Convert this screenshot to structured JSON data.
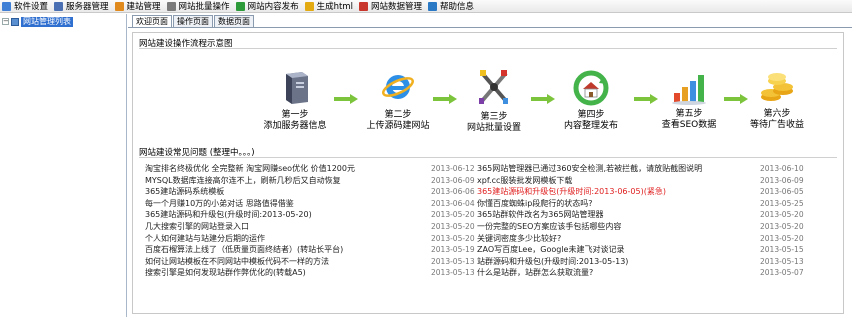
{
  "menubar": [
    {
      "label": "软件设置",
      "color": "#3f7fd6"
    },
    {
      "label": "服务器管理",
      "color": "#4a6fb3"
    },
    {
      "label": "建站管理",
      "color": "#e08a1e"
    },
    {
      "label": "网站批量操作",
      "color": "#7a7a7a"
    },
    {
      "label": "网站内容发布",
      "color": "#2d9b3a"
    },
    {
      "label": "生成html",
      "color": "#e3aa12"
    },
    {
      "label": "网站数据管理",
      "color": "#c8362c"
    },
    {
      "label": "帮助信息",
      "color": "#2a79c4"
    }
  ],
  "sidebar": {
    "toggle": "−",
    "tree_root": "网站管理列表"
  },
  "tabs": [
    "欢迎页面",
    "操作页面",
    "数据页面"
  ],
  "flow": {
    "title": "网站建设操作流程示意图",
    "steps": [
      {
        "line1": "第一步",
        "line2": "添加服务器信息",
        "icon": "server-icon"
      },
      {
        "line1": "第二步",
        "line2": "上传源码建网站",
        "icon": "ie-icon"
      },
      {
        "line1": "第三步",
        "line2": "网站批量设置",
        "icon": "tools-icon"
      },
      {
        "line1": "第四步",
        "line2": "内容整理发布",
        "icon": "home-refresh-icon"
      },
      {
        "line1": "第五步",
        "line2": "查看SEO数据",
        "icon": "bar-chart-icon"
      },
      {
        "line1": "第六步",
        "line2": "等待广告收益",
        "icon": "coins-icon"
      }
    ]
  },
  "faq": {
    "title": "网站建设常见问题 (整理中。。。)",
    "left": [
      {
        "title": "淘宝排名终极优化 全完整新 淘宝网赚seo优化 价值1200元",
        "date": "2013-06-12"
      },
      {
        "title": "MYSQL数据库连接高尔连不上，刷新几秒后又自动恢复",
        "date": "2013-06-09"
      },
      {
        "title": "365建站源码系统模板",
        "date": "2013-06-06"
      },
      {
        "title": "每一个月赚10万的小弟对话 思路值得借鉴",
        "date": "2013-06-04"
      },
      {
        "title": "365建站源码和升级包(升级时间:2013-05-20)",
        "date": "2013-05-20"
      },
      {
        "title": "几大搜索引擎的网站登录入口",
        "date": "2013-05-20"
      },
      {
        "title": "个人如何建站与站建分后期的运作",
        "date": "2013-05-20"
      },
      {
        "title": "百度石榴算法上线了（低质量页面终结者）(转站长平台)",
        "date": "2013-05-19"
      },
      {
        "title": "如何让网站模板在不同网站中模板代码不一样的方法",
        "date": "2013-05-13"
      },
      {
        "title": "搜索引擎是如何发现站群作弊优化的(转载A5)",
        "date": "2013-05-13"
      }
    ],
    "right": [
      {
        "title": "365网站管理器已通过360安全检测,若被拦截，请放贴截图说明",
        "date": "2013-06-10",
        "highlight": false
      },
      {
        "title": "xpf.cc服装批发网模板下载",
        "date": "2013-06-09",
        "highlight": false
      },
      {
        "title": "365建站源码和升级包(升级时间:2013-06-05)(紧急)",
        "date": "2013-06-05",
        "highlight": true
      },
      {
        "title": "你懂百度蜘蛛ip段爬行的状态吗?",
        "date": "2013-05-25",
        "highlight": false
      },
      {
        "title": "365站群软件改名为365网站管理器",
        "date": "2013-05-20",
        "highlight": false
      },
      {
        "title": "一份完整的SEO方案应该手包括哪些内容",
        "date": "2013-05-20",
        "highlight": false
      },
      {
        "title": "关键词密度多少比较好?",
        "date": "2013-05-20",
        "highlight": false
      },
      {
        "title": "ZAO写百度Lee，Google未建飞对谈记录",
        "date": "2013-05-15",
        "highlight": false
      },
      {
        "title": "站群源码和升级包(升级时间:2013-05-13)",
        "date": "2013-05-13",
        "highlight": false
      },
      {
        "title": "什么是站群，站群怎么获取流量?",
        "date": "2013-05-07",
        "highlight": false
      }
    ]
  }
}
